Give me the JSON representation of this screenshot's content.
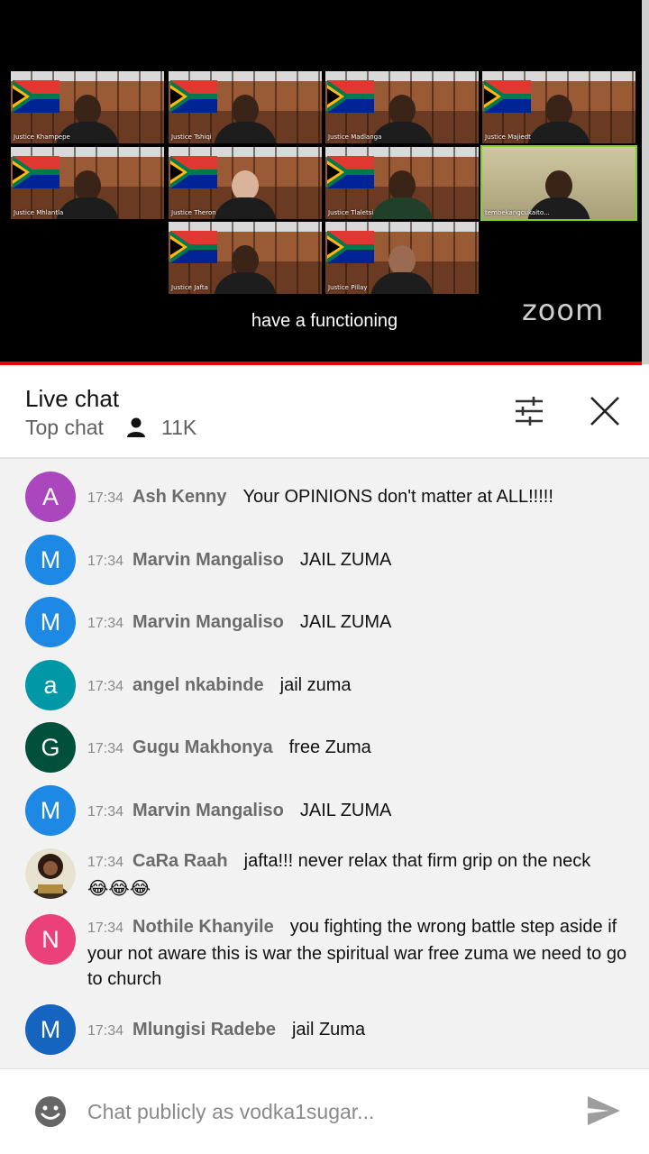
{
  "video": {
    "caption": "have a functioning",
    "logo": "zoom",
    "tiles": [
      "Justice Khampepe",
      "Justice Tshiqi",
      "Justice Madlanga",
      "Justice Majiedt",
      "Justice Mhlantla",
      "Justice Theron",
      "Justice Tlaletsi",
      "tembekangcukaito...",
      "Justice Jafta",
      "Justice Pillay"
    ],
    "active_tile_border": "#7ed321",
    "progress_color": "#ee0000"
  },
  "header": {
    "title": "Live chat",
    "mode": "Top chat",
    "viewers": "11K",
    "icons": {
      "viewers": "person-icon",
      "filter": "sliders-icon",
      "close": "close-icon"
    }
  },
  "messages": [
    {
      "initial": "A",
      "color": "#ab47bc",
      "time": "17:34",
      "author": "Ash Kenny",
      "text": "Your OPINIONS don't matter at ALL!!!!!"
    },
    {
      "initial": "M",
      "color": "#1e88e5",
      "time": "17:34",
      "author": "Marvin Mangaliso",
      "text": "JAIL ZUMA"
    },
    {
      "initial": "M",
      "color": "#1e88e5",
      "time": "17:34",
      "author": "Marvin Mangaliso",
      "text": "JAIL ZUMA"
    },
    {
      "initial": "a",
      "color": "#0097a7",
      "time": "17:34",
      "author": "angel nkabinde",
      "text": "jail zuma"
    },
    {
      "initial": "G",
      "color": "#00503c",
      "time": "17:34",
      "author": "Gugu Makhonya",
      "text": "free Zuma"
    },
    {
      "initial": "M",
      "color": "#1e88e5",
      "time": "17:34",
      "author": "Marvin Mangaliso",
      "text": "JAIL ZUMA"
    },
    {
      "initial": "",
      "color": "#6b5a3a",
      "time": "17:34",
      "author": "CaRa Raah",
      "text": "jafta!!! never relax that firm grip on the neck",
      "emoji": "😂😂😂"
    },
    {
      "initial": "N",
      "color": "#ec407a",
      "time": "17:34",
      "author": "Nothile Khanyile",
      "text": "you fighting the wrong battle step aside if your not aware this is war the spiritual war free zuma we need to go to church"
    },
    {
      "initial": "M",
      "color": "#1565c0",
      "time": "17:34",
      "author": "Mlungisi Radebe",
      "text": "jail Zuma"
    }
  ],
  "input": {
    "placeholder": "Chat publicly as vodka1sugar...",
    "icons": {
      "emoji": "smiley-icon",
      "send": "send-icon"
    }
  }
}
